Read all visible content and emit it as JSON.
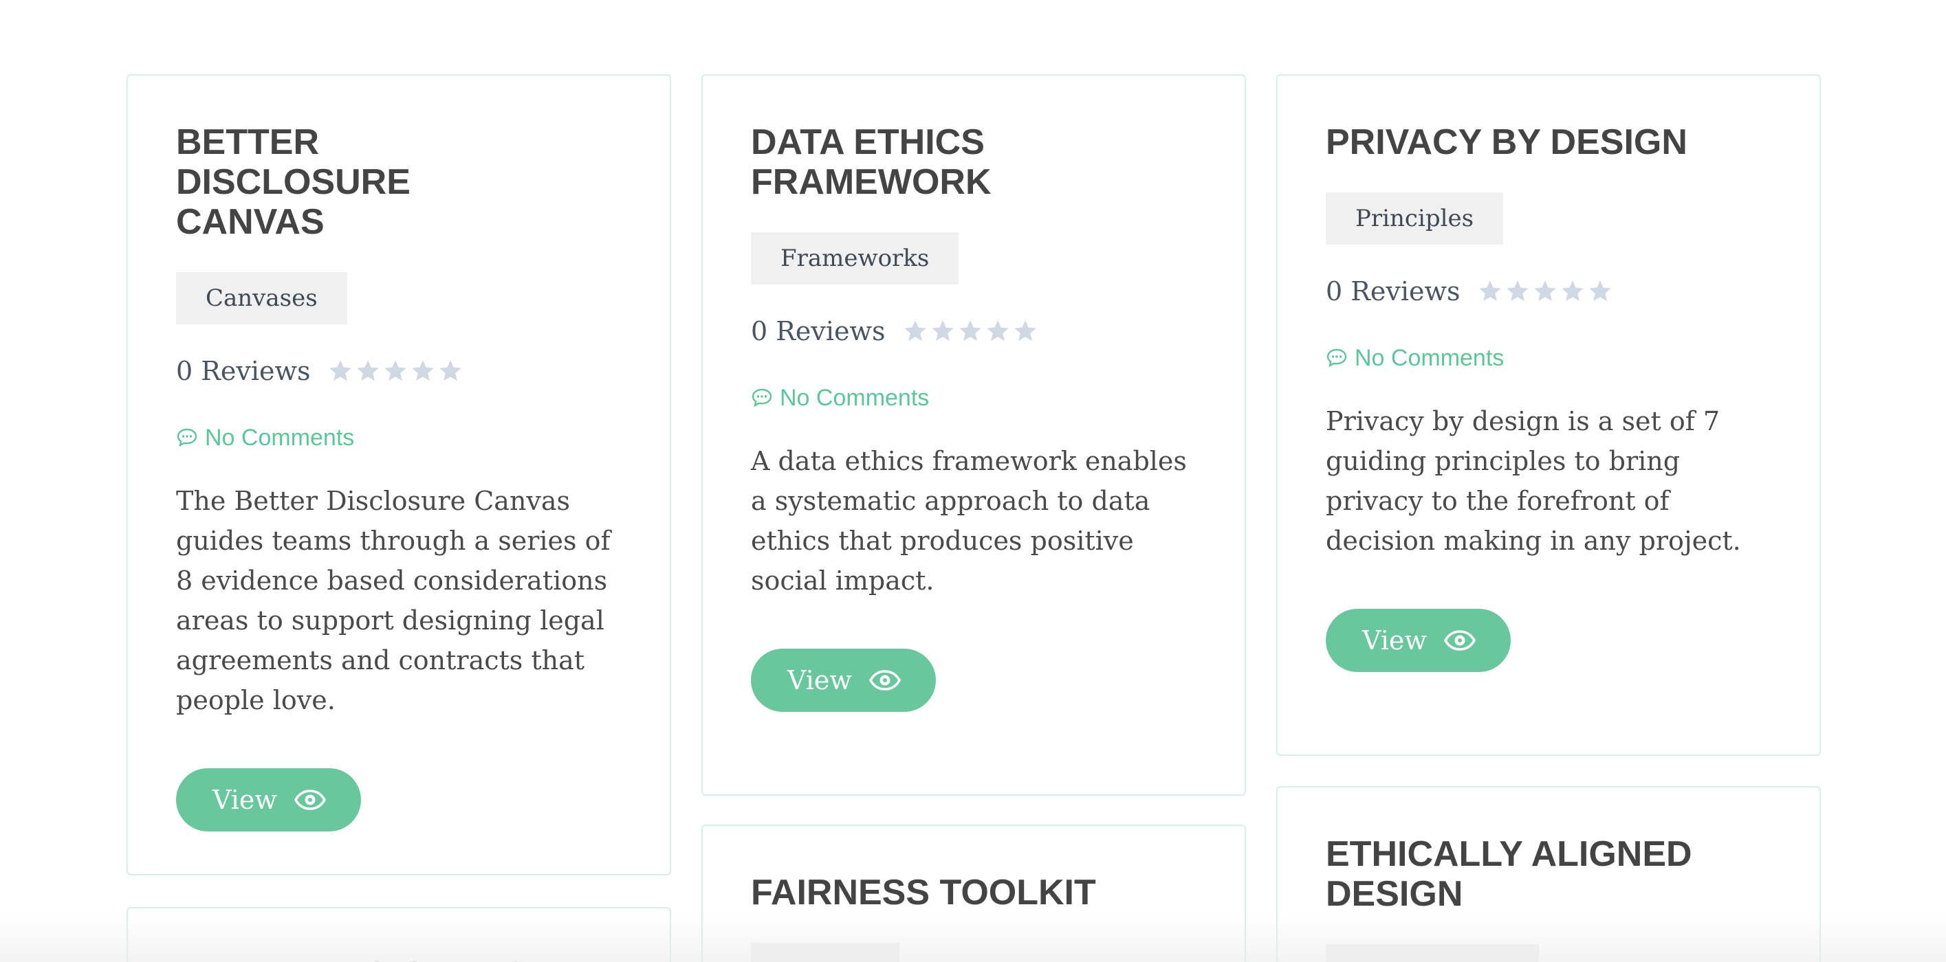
{
  "cards": [
    {
      "title": "BETTER DISCLOSURE CANVAS",
      "tag": "Canvases",
      "reviews": "0 Reviews",
      "rating": 0,
      "comments": "No Comments",
      "description": "The Better Disclosure Canvas guides teams through a series of 8 evidence based considerations areas to support designing legal agreements and contracts that people love.",
      "button": "View"
    },
    {
      "title": "DATA ETHICS FRAMEWORK",
      "tag": "Frameworks",
      "reviews": "0 Reviews",
      "rating": 0,
      "comments": "No Comments",
      "description": "A data ethics framework enables a systematic approach to data ethics that produces positive social impact.",
      "button": "View"
    },
    {
      "title": "PRIVACY BY DESIGN",
      "tag": "Principles",
      "reviews": "0 Reviews",
      "rating": 0,
      "comments": "No Comments",
      "description": "Privacy by design is a set of 7 guiding principles to bring privacy to the forefront of decision making in any project.",
      "button": "View"
    },
    {
      "title": "WELLBEING CARDS"
    },
    {
      "title": "FAIRNESS TOOLKIT"
    },
    {
      "title": "ETHICALLY ALIGNED DESIGN"
    }
  ],
  "colors": {
    "accent": "#68c79d",
    "comment_green": "#5cc69a",
    "card_border": "#d8efe8",
    "star": "#cfd8e3",
    "title": "#444444",
    "tag_bg": "#f0f0f0"
  },
  "icons": {
    "star": "star-icon",
    "comment": "speech-bubble-icon",
    "view": "eye-icon"
  }
}
